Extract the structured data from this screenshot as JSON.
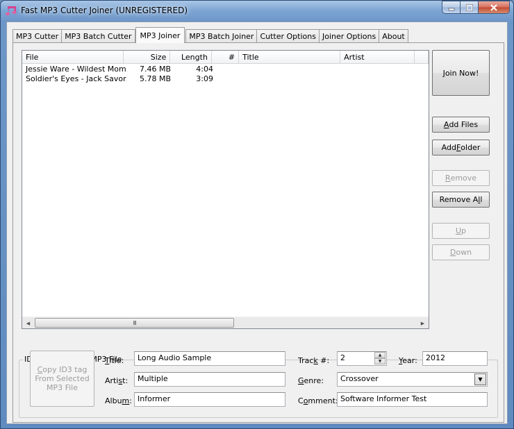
{
  "window": {
    "title": "Fast MP3 Cutter Joiner (UNREGISTERED)",
    "icon": "music-note-icon",
    "controls": {
      "minimize": "minimize-icon",
      "maximize": "maximize-icon",
      "close": "close-icon"
    }
  },
  "tabs": [
    {
      "label": "MP3 Cutter",
      "active": false
    },
    {
      "label": "MP3 Batch Cutter",
      "active": false
    },
    {
      "label": "MP3 Joiner",
      "active": true
    },
    {
      "label": "MP3 Batch Joiner",
      "active": false
    },
    {
      "label": "Cutter Options",
      "active": false
    },
    {
      "label": "Joiner Options",
      "active": false
    },
    {
      "label": "About",
      "active": false
    }
  ],
  "file_list": {
    "columns": [
      "File",
      "Size",
      "Length",
      "#",
      "Title",
      "Artist"
    ],
    "rows": [
      {
        "file": "Jessie Ware - Wildest Mom...",
        "size": "7.46 MB",
        "length": "4:04",
        "track": "",
        "title": "",
        "artist": ""
      },
      {
        "file": "Soldier's Eyes - Jack Savor...",
        "size": "5.78 MB",
        "length": "3:09",
        "track": "",
        "title": "",
        "artist": ""
      }
    ],
    "scrollbar_grip": "III"
  },
  "buttons": {
    "join_now": {
      "pre": "",
      "accel": "J",
      "post": "oin Now!",
      "enabled": true
    },
    "add_files": {
      "pre": "",
      "accel": "A",
      "post": "dd Files",
      "enabled": true
    },
    "add_folder": {
      "pre": "Add ",
      "accel": "F",
      "post": "older",
      "enabled": true
    },
    "remove": {
      "pre": "",
      "accel": "R",
      "post": "emove",
      "enabled": false
    },
    "remove_all": {
      "pre": "Remove A",
      "accel": "l",
      "post": "l",
      "enabled": true
    },
    "up": {
      "pre": "",
      "accel": "U",
      "post": "p",
      "enabled": false
    },
    "down": {
      "pre": "",
      "accel": "D",
      "post": "own",
      "enabled": false
    }
  },
  "id3": {
    "group_label": "ID3 tag of Target MP3 File",
    "copy_button": {
      "accel": "C",
      "line1_rest": "opy ID3 tag",
      "line2": "From Selected",
      "line3": "MP3 File",
      "enabled": false
    },
    "title": {
      "pre": "",
      "accel": "T",
      "post": "itle:",
      "value": "Long Audio Sample"
    },
    "artist": {
      "pre": "Arti",
      "accel": "s",
      "post": "t:",
      "value": "Multiple"
    },
    "album": {
      "pre": "Albu",
      "accel": "m",
      "post": ":",
      "value": "Informer"
    },
    "track": {
      "pre": "Trac",
      "accel": "k",
      "post": " #:",
      "value": "2"
    },
    "year": {
      "pre": "",
      "accel": "Y",
      "post": "ear:",
      "value": "2012"
    },
    "genre": {
      "pre": "",
      "accel": "G",
      "post": "enre:",
      "value": "Crossover"
    },
    "comment": {
      "pre": "C",
      "accel": "o",
      "post": "mment:",
      "value": "Software Informer Test"
    }
  }
}
